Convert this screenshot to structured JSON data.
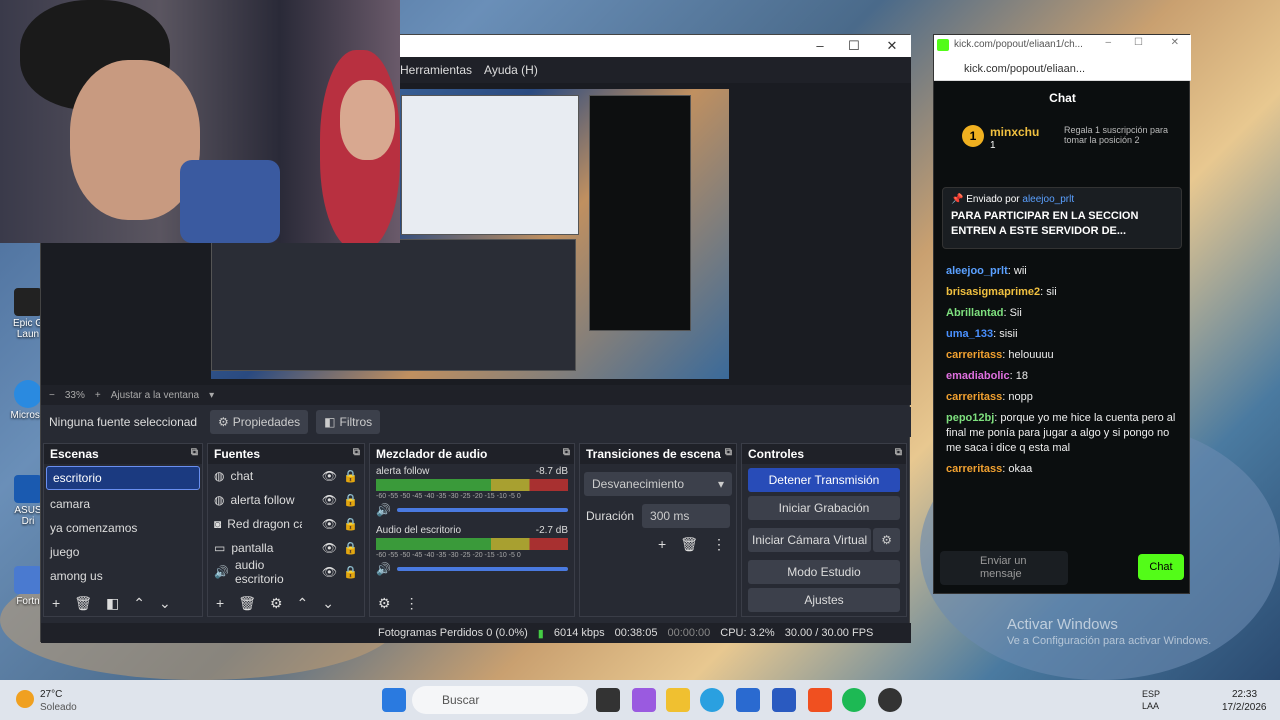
{
  "desktop": {
    "icons": [
      {
        "label": "Epic G Laun"
      },
      {
        "label": "Microso"
      },
      {
        "label": "ASUS Dri"
      },
      {
        "label": "Fortn"
      }
    ],
    "watermark_title": "Activar Windows",
    "watermark_sub": "Ve a Configuración para activar Windows."
  },
  "obs": {
    "menu": [
      "Herramientas",
      "Ayuda (H)"
    ],
    "zoom": {
      "percent": "33%",
      "fit": "Ajustar a la ventana"
    },
    "source_bar": {
      "status": "Ninguna fuente seleccionad",
      "properties": "Propiedades",
      "filters": "Filtros"
    },
    "scenes": {
      "title": "Escenas",
      "items": [
        "escritorio",
        "camara",
        "ya comenzamos",
        "juego",
        "among us"
      ],
      "selected": "escritorio"
    },
    "sources": {
      "title": "Fuentes",
      "items": [
        {
          "label": "chat",
          "icon": "globe-icon"
        },
        {
          "label": "alerta follow",
          "icon": "globe-icon"
        },
        {
          "label": "Red dragon cam",
          "icon": "camera-icon"
        },
        {
          "label": "pantalla",
          "icon": "monitor-icon"
        },
        {
          "label": "audio escritorio",
          "icon": "speaker-icon"
        }
      ]
    },
    "mixer": {
      "title": "Mezclador de audio",
      "channels": [
        {
          "name": "alerta follow",
          "db": "-8.7 dB"
        },
        {
          "name": "Audio del escritorio",
          "db": "-2.7 dB"
        }
      ],
      "scale": "-60 -55 -50 -45 -40 -35 -30 -25 -20 -15 -10 -5 0"
    },
    "transitions": {
      "title": "Transiciones de escena",
      "selected": "Desvanecimiento",
      "duration_label": "Duración",
      "duration_value": "300 ms"
    },
    "controls": {
      "title": "Controles",
      "buttons": [
        "Detener Transmisión",
        "Iniciar Grabación",
        "Iniciar Cámara Virtual",
        "Modo Estudio",
        "Ajustes"
      ]
    },
    "status": {
      "dropped": "Fotogramas Perdidos 0 (0.0%)",
      "bitrate": "6014 kbps",
      "stream_time": "00:38:05",
      "rec_time": "00:00:00",
      "cpu": "CPU: 3.2%",
      "fps": "30.00 / 30.00 FPS"
    }
  },
  "kick": {
    "window_title": "kick.com/popout/eliaan1/ch...",
    "url": "kick.com/popout/eliaan...",
    "header": "Chat",
    "top_gifter": {
      "rank": "1",
      "name": "minxchu",
      "count": "1",
      "cta": "Regala 1 suscripción para tomar la posición 2"
    },
    "pinned": {
      "label": "Enviado por",
      "user": "aleejoo_prlt",
      "text": "PARA PARTICIPAR EN LA SECCION ENTREN A ESTE SERVIDOR DE..."
    },
    "messages": [
      {
        "user": "aleejoo_prlt",
        "color": "#5aa0ff",
        "text": "wii"
      },
      {
        "user": "brisasigmaprime2",
        "color": "#f0c040",
        "text": "sii"
      },
      {
        "user": "Abrillantad",
        "color": "#7ee07e",
        "text": "Sii"
      },
      {
        "user": "uma_133",
        "color": "#4a90ff",
        "text": "sisii"
      },
      {
        "user": "carreritass",
        "color": "#f0a030",
        "text": "helouuuu"
      },
      {
        "user": "emadiabolic",
        "color": "#e070e0",
        "text": "18"
      },
      {
        "user": "carreritass",
        "color": "#f0a030",
        "text": "nopp"
      },
      {
        "user": "pepo12bj",
        "color": "#7ee07e",
        "text": "porque yo me hice la cuenta pero al final me ponía para jugar a algo y si pongo no me saca i dice q esta mal"
      },
      {
        "user": "carreritass",
        "color": "#f0a030",
        "text": "okaa"
      }
    ],
    "input_placeholder": "Enviar un mensaje",
    "send_label": "Chat"
  },
  "taskbar": {
    "weather_temp": "27°C",
    "weather_desc": "Soleado",
    "search": "Buscar",
    "lang": "ESP",
    "lang2": "LAA",
    "time": "22:33",
    "date": "17/2/2026"
  }
}
